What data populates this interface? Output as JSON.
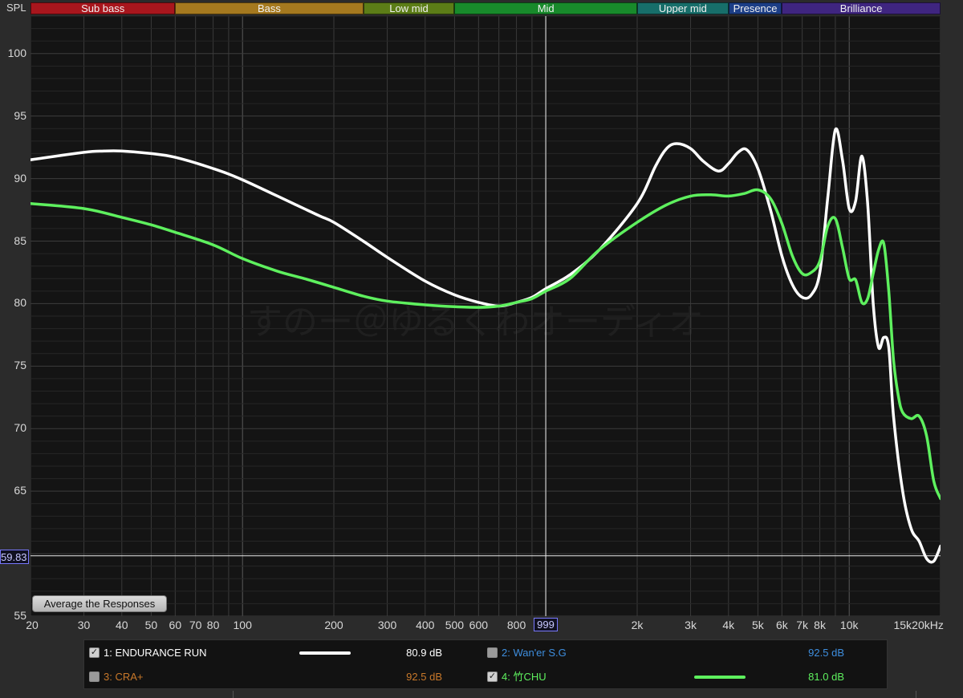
{
  "header": {
    "spl_label": "SPL"
  },
  "bands": [
    {
      "label": "Sub bass",
      "color": "#a8161d",
      "from": 20,
      "to": 60
    },
    {
      "label": "Bass",
      "color": "#a5791f",
      "from": 60,
      "to": 250
    },
    {
      "label": "Low mid",
      "color": "#5c7d17",
      "from": 250,
      "to": 500
    },
    {
      "label": "Mid",
      "color": "#188a2b",
      "from": 500,
      "to": 2000
    },
    {
      "label": "Upper mid",
      "color": "#176e6a",
      "from": 2000,
      "to": 4000
    },
    {
      "label": "Presence",
      "color": "#1c3e86",
      "from": 4000,
      "to": 6000
    },
    {
      "label": "Brilliance",
      "color": "#3f2580",
      "from": 6000,
      "to": 20000
    }
  ],
  "y_axis": {
    "ticks": [
      "100",
      "95",
      "90",
      "85",
      "80",
      "75",
      "70",
      "65",
      "55"
    ],
    "cursor_value": "59.83"
  },
  "x_axis": {
    "ticks": [
      {
        "f": 20,
        "label": "20"
      },
      {
        "f": 30,
        "label": "30"
      },
      {
        "f": 40,
        "label": "40"
      },
      {
        "f": 50,
        "label": "50"
      },
      {
        "f": 60,
        "label": "60"
      },
      {
        "f": 70,
        "label": "70"
      },
      {
        "f": 80,
        "label": "80"
      },
      {
        "f": 100,
        "label": "100"
      },
      {
        "f": 200,
        "label": "200"
      },
      {
        "f": 300,
        "label": "300"
      },
      {
        "f": 400,
        "label": "400"
      },
      {
        "f": 500,
        "label": "500"
      },
      {
        "f": 600,
        "label": "600"
      },
      {
        "f": 800,
        "label": "800"
      },
      {
        "f": 2000,
        "label": "2k"
      },
      {
        "f": 3000,
        "label": "3k"
      },
      {
        "f": 4000,
        "label": "4k"
      },
      {
        "f": 5000,
        "label": "5k"
      },
      {
        "f": 6000,
        "label": "6k"
      },
      {
        "f": 7000,
        "label": "7k"
      },
      {
        "f": 8000,
        "label": "8k"
      },
      {
        "f": 10000,
        "label": "10k"
      },
      {
        "f": 15000,
        "label": "15k"
      },
      {
        "f": 20000,
        "label": "20kHz"
      }
    ],
    "cursor_value": "999"
  },
  "watermark": "すのー＠ゆるくわオーディオ",
  "buttons": {
    "average": "Average the Responses"
  },
  "legend": [
    {
      "index_label": "1: ENDURANCE RUN",
      "checked": true,
      "value": "80.9 dB",
      "color": "#ffffff",
      "line": true
    },
    {
      "index_label": "2: Wan'er S.G",
      "checked": false,
      "value": "92.5 dB",
      "color": "#3e8ede",
      "line": false
    },
    {
      "index_label": "3: CRA+",
      "checked": false,
      "value": "92.5 dB",
      "color": "#c8782a",
      "line": false
    },
    {
      "index_label": "4: 竹CHU",
      "checked": true,
      "value": "81.0 dB",
      "color": "#5ef05e",
      "line": true
    }
  ],
  "chart_data": {
    "type": "line",
    "x_scale": "log",
    "xlim": [
      20,
      20000
    ],
    "ylim": [
      55,
      103
    ],
    "ylabel": "SPL",
    "grid": true,
    "cursor": {
      "x": 999,
      "y": 59.83
    },
    "series": [
      {
        "name": "1: ENDURANCE RUN",
        "color": "#ffffff",
        "points": [
          [
            20,
            91.5
          ],
          [
            30,
            92.1
          ],
          [
            35,
            92.2
          ],
          [
            40,
            92.2
          ],
          [
            50,
            92.0
          ],
          [
            60,
            91.7
          ],
          [
            80,
            90.8
          ],
          [
            100,
            89.9
          ],
          [
            150,
            87.9
          ],
          [
            180,
            87.0
          ],
          [
            200,
            86.5
          ],
          [
            250,
            85.0
          ],
          [
            300,
            83.7
          ],
          [
            400,
            81.8
          ],
          [
            500,
            80.7
          ],
          [
            600,
            80.1
          ],
          [
            700,
            79.8
          ],
          [
            800,
            80.1
          ],
          [
            900,
            80.5
          ],
          [
            1000,
            81.2
          ],
          [
            1200,
            82.3
          ],
          [
            1500,
            84.3
          ],
          [
            2000,
            88.0
          ],
          [
            2300,
            91.0
          ],
          [
            2500,
            92.4
          ],
          [
            2700,
            92.8
          ],
          [
            3000,
            92.4
          ],
          [
            3300,
            91.4
          ],
          [
            3700,
            90.6
          ],
          [
            4000,
            91.2
          ],
          [
            4300,
            92.1
          ],
          [
            4600,
            92.3
          ],
          [
            5000,
            90.8
          ],
          [
            5500,
            87.5
          ],
          [
            6000,
            83.8
          ],
          [
            6500,
            81.5
          ],
          [
            7000,
            80.5
          ],
          [
            7500,
            80.7
          ],
          [
            8000,
            82.5
          ],
          [
            8500,
            88.5
          ],
          [
            9000,
            93.9
          ],
          [
            9500,
            91.5
          ],
          [
            10000,
            87.6
          ],
          [
            10500,
            88.2
          ],
          [
            11000,
            91.8
          ],
          [
            11500,
            88.0
          ],
          [
            12000,
            80.0
          ],
          [
            12500,
            76.5
          ],
          [
            13000,
            77.3
          ],
          [
            13500,
            76.5
          ],
          [
            14000,
            71.0
          ],
          [
            15000,
            65.0
          ],
          [
            16000,
            62.0
          ],
          [
            17000,
            61.0
          ],
          [
            18000,
            59.6
          ],
          [
            19000,
            59.4
          ],
          [
            20000,
            60.6
          ]
        ]
      },
      {
        "name": "4: 竹CHU",
        "color": "#5ef05e",
        "points": [
          [
            20,
            88.0
          ],
          [
            30,
            87.6
          ],
          [
            40,
            86.9
          ],
          [
            50,
            86.3
          ],
          [
            60,
            85.7
          ],
          [
            80,
            84.7
          ],
          [
            100,
            83.6
          ],
          [
            130,
            82.6
          ],
          [
            160,
            82.0
          ],
          [
            200,
            81.3
          ],
          [
            250,
            80.6
          ],
          [
            300,
            80.2
          ],
          [
            400,
            79.9
          ],
          [
            500,
            79.75
          ],
          [
            600,
            79.7
          ],
          [
            700,
            79.8
          ],
          [
            800,
            80.1
          ],
          [
            900,
            80.4
          ],
          [
            1000,
            81.0
          ],
          [
            1200,
            82.0
          ],
          [
            1500,
            84.3
          ],
          [
            2000,
            86.5
          ],
          [
            2500,
            87.9
          ],
          [
            3000,
            88.6
          ],
          [
            3500,
            88.7
          ],
          [
            4000,
            88.6
          ],
          [
            4500,
            88.8
          ],
          [
            5000,
            89.1
          ],
          [
            5500,
            88.4
          ],
          [
            6000,
            86.4
          ],
          [
            6500,
            83.8
          ],
          [
            7000,
            82.4
          ],
          [
            7500,
            82.5
          ],
          [
            8000,
            83.4
          ],
          [
            8500,
            86.2
          ],
          [
            9000,
            86.8
          ],
          [
            9500,
            84.5
          ],
          [
            10000,
            82.0
          ],
          [
            10500,
            81.9
          ],
          [
            11000,
            80.1
          ],
          [
            11500,
            80.4
          ],
          [
            12000,
            82.4
          ],
          [
            12500,
            84.3
          ],
          [
            13000,
            84.8
          ],
          [
            13500,
            81.0
          ],
          [
            14000,
            75.5
          ],
          [
            14500,
            72.7
          ],
          [
            15000,
            71.3
          ],
          [
            16000,
            70.8
          ],
          [
            17000,
            71.0
          ],
          [
            18000,
            69.4
          ],
          [
            19000,
            65.8
          ],
          [
            20000,
            64.4
          ]
        ]
      }
    ]
  }
}
